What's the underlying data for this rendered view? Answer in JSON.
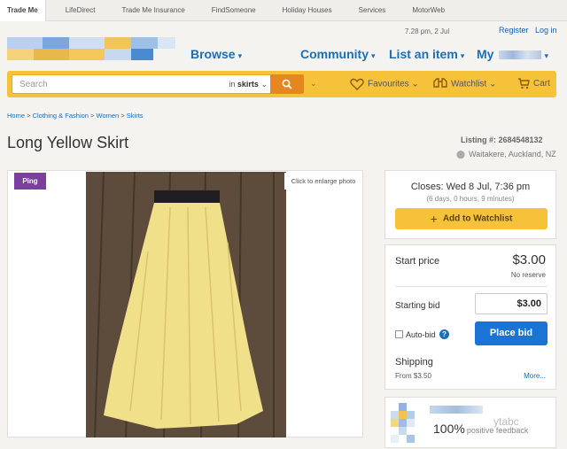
{
  "top_nav": [
    "Trade Me",
    "LifeDirect",
    "Trade Me Insurance",
    "FindSomeone",
    "Holiday Houses",
    "Services",
    "MotorWeb"
  ],
  "header": {
    "datetime": "7.28 pm, 2 Jul",
    "register": "Register",
    "login": "Log in",
    "nav": [
      "Browse",
      "Community",
      "List an item",
      "My"
    ]
  },
  "search": {
    "placeholder": "Search",
    "scope_prefix": "in",
    "scope": "skirts",
    "favourites": "Favourites",
    "watchlist": "Watchlist",
    "cart": "Cart"
  },
  "breadcrumb": [
    "Home",
    "Clothing & Fashion",
    "Women",
    "Skirts"
  ],
  "listing": {
    "title": "Long Yellow Skirt",
    "number": "Listing #: 2684548132",
    "location": "Waitakere, Auckland, NZ",
    "ping_badge": "Ping",
    "enlarge": "Click to enlarge photo"
  },
  "closing": {
    "closes": "Closes: Wed 8 Jul, 7:36 pm",
    "remaining": "(6 days, 0 hours, 9 minutes)",
    "watchlist_button": "Add to Watchlist"
  },
  "bidding": {
    "start_price_label": "Start price",
    "start_price": "$3.00",
    "reserve": "No reserve",
    "starting_bid_label": "Starting bid",
    "starting_bid_value": "$3.00",
    "auto_bid": "Auto-bid",
    "place_bid": "Place bid",
    "shipping_label": "Shipping",
    "shipping_from": "From $3.50",
    "more": "More..."
  },
  "seller": {
    "feedback_percent": "100%",
    "feedback_label": "positive feedback",
    "watermark": "ytabc"
  },
  "colors": {
    "brand_yellow": "#f5c23a",
    "link_blue": "#1a6fb8",
    "bid_blue": "#1a74d6",
    "ping_purple": "#7b3fa0",
    "search_orange": "#e5861f"
  }
}
